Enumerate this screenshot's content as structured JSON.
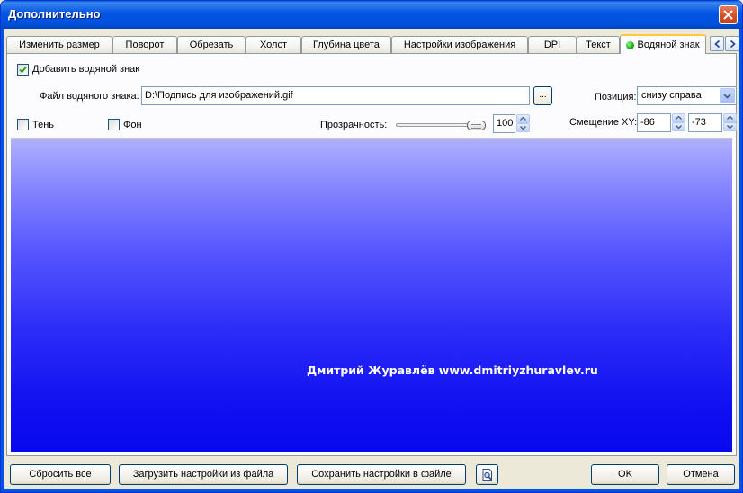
{
  "window": {
    "title": "Дополнительно"
  },
  "tabs": [
    {
      "label": "Изменить размер"
    },
    {
      "label": "Поворот"
    },
    {
      "label": "Обрезать"
    },
    {
      "label": "Холст"
    },
    {
      "label": "Глубина цвета"
    },
    {
      "label": "Настройки изображения"
    },
    {
      "label": "DPI"
    },
    {
      "label": "Текст"
    },
    {
      "label": "Водяной знак",
      "active": true
    }
  ],
  "watermark_panel": {
    "add_watermark_label": "Добавить водяной знак",
    "add_watermark_checked": true,
    "file_label": "Файл водяного знака:",
    "file_value": "D:\\Подпись для изображений.gif",
    "browse_label": "...",
    "position_label": "Позиция:",
    "position_value": "снизу справа",
    "shadow_label": "Тень",
    "shadow_checked": false,
    "background_label": "Фон",
    "background_checked": false,
    "opacity_label": "Прозрачность:",
    "opacity_value": "100",
    "offset_label": "Смещение XY:",
    "offset_x": "-86",
    "offset_y": "-73"
  },
  "preview": {
    "watermark_text": "Дмитрий Журавлёв www.dmitriyzhuravlev.ru"
  },
  "footer": {
    "reset_label": "Сбросить все",
    "load_label": "Загрузить настройки из файла",
    "save_label": "Сохранить настройки в файле",
    "preview_icon": "magnifier-page-icon",
    "ok_label": "OK",
    "cancel_label": "Отмена"
  },
  "colors": {
    "titlebar": "#0054e3",
    "active_tab_accent": "#ffc83c",
    "preview_top": "#b0b0ff",
    "preview_bottom": "#0808ee"
  }
}
